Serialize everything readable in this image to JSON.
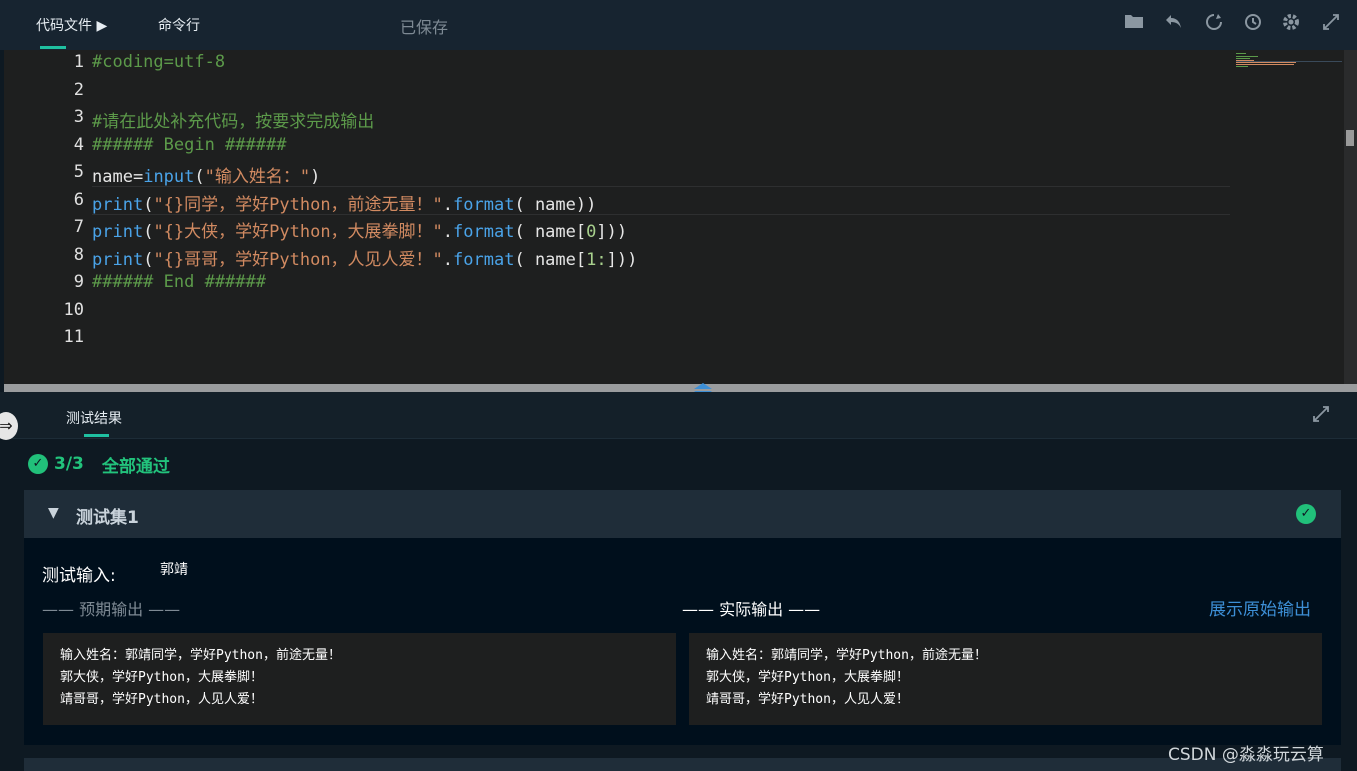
{
  "top": {
    "tabs": [
      "代码文件 ▶",
      "命令行"
    ],
    "status": "已保存",
    "icons": [
      "folder-icon",
      "undo-icon",
      "refresh-icon",
      "history-icon",
      "gear-icon",
      "fullscreen-icon"
    ]
  },
  "editor": {
    "line_numbers": [
      "1",
      "2",
      "3",
      "4",
      "5",
      "6",
      "7",
      "8",
      "9",
      "10",
      "11"
    ],
    "lines": [
      [
        {
          "t": "#coding=utf-8",
          "c": "com"
        }
      ],
      [],
      [
        {
          "t": "#请在此处补充代码，按要求完成输出",
          "c": "com"
        }
      ],
      [
        {
          "t": "###### Begin ######",
          "c": "com"
        }
      ],
      [
        {
          "t": "name",
          "c": "txt"
        },
        {
          "t": "=",
          "c": "txt"
        },
        {
          "t": "input",
          "c": "fn"
        },
        {
          "t": "(",
          "c": "br"
        },
        {
          "t": "\"输入姓名：\"",
          "c": "str"
        },
        {
          "t": ")",
          "c": "br"
        }
      ],
      [
        {
          "t": "print",
          "c": "fn"
        },
        {
          "t": "(",
          "c": "br"
        },
        {
          "t": "\"{}同学，学好Python，前途无量！\"",
          "c": "str"
        },
        {
          "t": ".",
          "c": "txt"
        },
        {
          "t": "format",
          "c": "fn"
        },
        {
          "t": "( name)",
          "c": "txt"
        },
        {
          "t": ")",
          "c": "br"
        }
      ],
      [
        {
          "t": "print",
          "c": "fn"
        },
        {
          "t": "(",
          "c": "br"
        },
        {
          "t": "\"{}大侠，学好Python，大展拳脚！\"",
          "c": "str"
        },
        {
          "t": ".",
          "c": "txt"
        },
        {
          "t": "format",
          "c": "fn"
        },
        {
          "t": "( name[",
          "c": "txt"
        },
        {
          "t": "0",
          "c": "num"
        },
        {
          "t": "]))",
          "c": "txt"
        }
      ],
      [
        {
          "t": "print",
          "c": "fn"
        },
        {
          "t": "(",
          "c": "br"
        },
        {
          "t": "\"{}哥哥，学好Python，人见人爱！\"",
          "c": "str"
        },
        {
          "t": ".",
          "c": "txt"
        },
        {
          "t": "format",
          "c": "fn"
        },
        {
          "t": "( name[",
          "c": "txt"
        },
        {
          "t": "1:",
          "c": "num"
        },
        {
          "t": "]))",
          "c": "txt"
        }
      ],
      [
        {
          "t": "###### End ######",
          "c": "com"
        }
      ],
      [],
      []
    ]
  },
  "results": {
    "tab_label": "测试结果",
    "passed": "3/3",
    "pass_text": "全部通过",
    "set_title": "测试集1",
    "input_label": "测试输入:",
    "input_value": "郭靖",
    "expected_label": "—— 预期输出 ——",
    "actual_label": "—— 实际输出 ——",
    "raw_link": "展示原始输出",
    "expected_lines": [
      "输入姓名：郭靖同学，学好Python，前途无量！",
      "郭大侠，学好Python，大展拳脚！",
      "靖哥哥，学好Python，人见人爱！"
    ],
    "actual_lines": [
      "输入姓名：郭靖同学，学好Python，前途无量！",
      "郭大侠，学好Python，大展拳脚！",
      "靖哥哥，学好Python，人见人爱！"
    ]
  },
  "watermark": "CSDN @淼淼玩云算",
  "colors": {
    "accent": "#1fc0a1",
    "pass": "#22c37c",
    "link": "#3d8fd6"
  }
}
